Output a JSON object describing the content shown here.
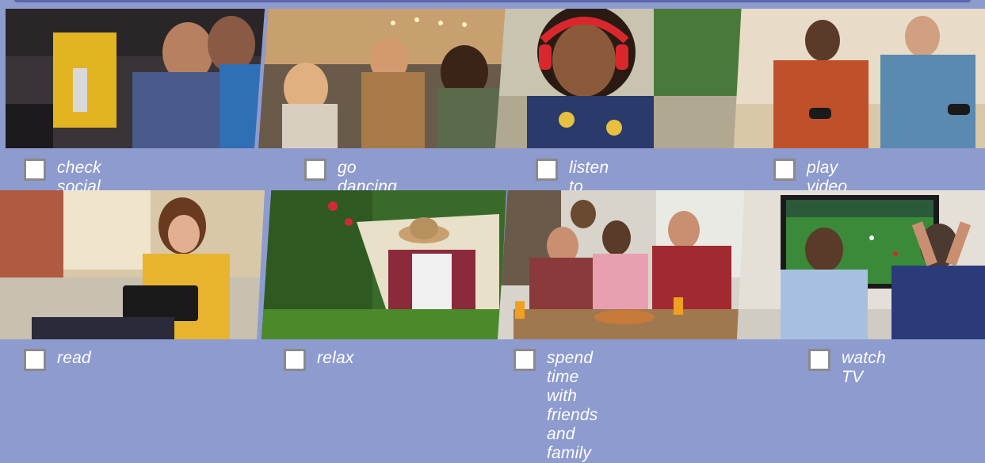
{
  "activities": [
    {
      "id": "social",
      "label": "check social media",
      "checked": false,
      "image": "friends-on-couch-with-tablet"
    },
    {
      "id": "dancing",
      "label": "go dancing",
      "checked": false,
      "image": "women-dancing-at-party"
    },
    {
      "id": "music",
      "label": "listen to music",
      "checked": false,
      "image": "woman-with-red-headphones"
    },
    {
      "id": "games",
      "label": "play video games",
      "checked": false,
      "image": "men-playing-video-games"
    },
    {
      "id": "read",
      "label": "read",
      "checked": false,
      "image": "woman-reading-tablet"
    },
    {
      "id": "relax",
      "label": "relax",
      "checked": false,
      "image": "man-in-hammock"
    },
    {
      "id": "friends",
      "label": "spend time with\nfriends and family",
      "checked": false,
      "image": "friends-eating-pizza"
    },
    {
      "id": "tv",
      "label": "watch TV",
      "checked": false,
      "image": "men-watching-football-on-tv"
    }
  ],
  "colors": {
    "background": "#8e9bcf",
    "label_text": "#ffffff",
    "checkbox_border": "#8a8a8a"
  }
}
